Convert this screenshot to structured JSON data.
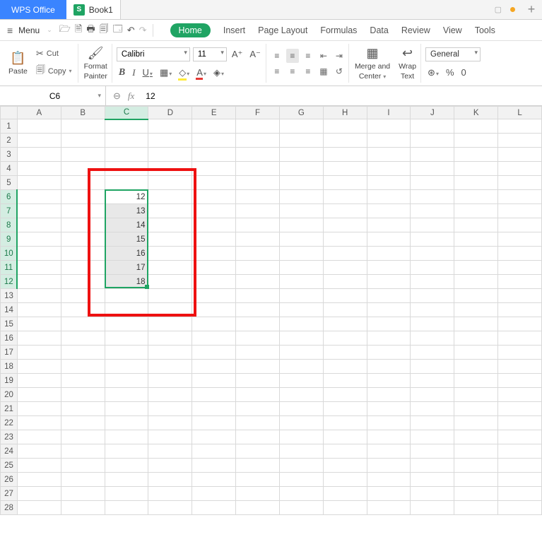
{
  "titlebar": {
    "app_name": "WPS Office",
    "doc_icon_letter": "S",
    "doc_name": "Book1",
    "plus": "+"
  },
  "menurow": {
    "menu_label": "Menu",
    "tabs": {
      "home": "Home",
      "insert": "Insert",
      "page_layout": "Page Layout",
      "formulas": "Formulas",
      "data": "Data",
      "review": "Review",
      "view": "View",
      "tools": "Tools"
    }
  },
  "ribbon": {
    "paste_label": "Paste",
    "cut_label": "Cut",
    "copy_label": "Copy",
    "format_painter_label1": "Format",
    "format_painter_label2": "Painter",
    "font_name": "Calibri",
    "font_size": "11",
    "merge_label1": "Merge and",
    "merge_label2": "Center",
    "wrap_label1": "Wrap",
    "wrap_label2": "Text",
    "number_format": "General"
  },
  "fxbar": {
    "cell_ref": "C6",
    "fx": "fx",
    "formula_value": "12"
  },
  "grid": {
    "columns": [
      "A",
      "B",
      "C",
      "D",
      "E",
      "F",
      "G",
      "H",
      "I",
      "J",
      "K",
      "L"
    ],
    "row_count": 28,
    "active_col": "C",
    "active_rows_start": 6,
    "active_rows_end": 12,
    "cells": {
      "C6": "12",
      "C7": "13",
      "C8": "14",
      "C9": "15",
      "C10": "16",
      "C11": "17",
      "C12": "18"
    }
  }
}
